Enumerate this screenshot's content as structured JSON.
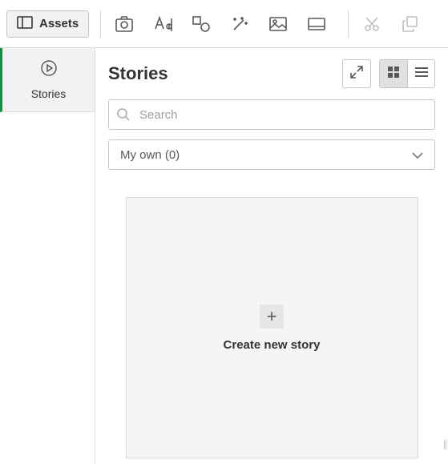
{
  "toolbar": {
    "assets_label": "Assets"
  },
  "sidebar": {
    "items": [
      {
        "label": "Stories"
      }
    ]
  },
  "panel": {
    "title": "Stories",
    "search_placeholder": "Search",
    "filter_label": "My own (0)",
    "create_label": "Create new story"
  }
}
